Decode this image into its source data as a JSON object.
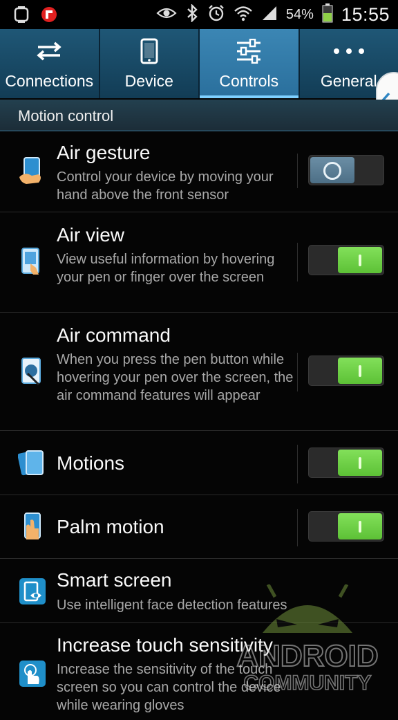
{
  "status_bar": {
    "battery": "54%",
    "time": "15:55",
    "icons": [
      "watch-icon",
      "flipboard-icon",
      "eye-icon",
      "bluetooth-icon",
      "alarm-icon",
      "wifi-icon",
      "signal-icon",
      "battery-icon"
    ],
    "battery_level": 0.54
  },
  "tabs": [
    {
      "label": "Connections",
      "icon": "swap-arrows-icon",
      "active": false
    },
    {
      "label": "Device",
      "icon": "phone-icon",
      "active": false
    },
    {
      "label": "Controls",
      "icon": "sliders-icon",
      "active": true
    },
    {
      "label": "General",
      "icon": "more-dots-icon",
      "active": false
    }
  ],
  "section": {
    "title": "Motion control"
  },
  "items": [
    {
      "title": "Air gesture",
      "desc": "Control your device by moving your hand above the front sensor",
      "toggle": "off"
    },
    {
      "title": "Air view",
      "desc": "View useful information by hovering your pen or finger over the screen",
      "toggle": "on"
    },
    {
      "title": "Air command",
      "desc": "When you press the pen button while hovering your pen over the screen, the air command features will appear",
      "toggle": "on"
    },
    {
      "title": "Motions",
      "toggle": "on"
    },
    {
      "title": "Palm motion",
      "toggle": "on"
    },
    {
      "title": "Smart screen",
      "desc": "Use intelligent face detection features"
    },
    {
      "title": "Increase touch sensitivity",
      "desc": "Increase the sensitivity of the touch screen so you can control the device while wearing gloves"
    }
  ],
  "watermark": {
    "line1": "ANDROID",
    "line2": "COMMUNITY"
  },
  "colors": {
    "accent": "#3b86b4",
    "toggle_on": "#6fd044",
    "toggle_off": "#5a7d94",
    "background": "#050505"
  }
}
